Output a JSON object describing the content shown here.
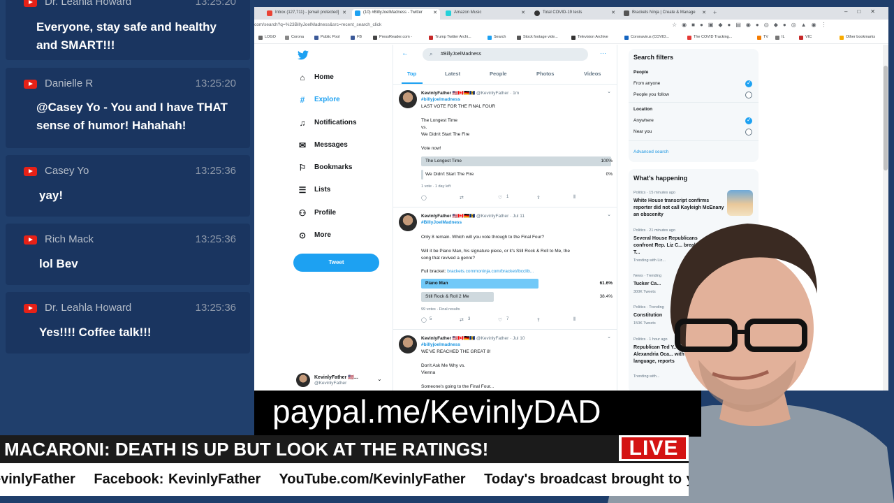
{
  "chat": {
    "messages": [
      {
        "name": "Dr. Leahla Howard",
        "time": "13:25:20",
        "text": "Everyone, stay safe and healthy and SMART!!!"
      },
      {
        "name": "Danielle R",
        "time": "13:25:20",
        "text": "@Casey Yo - You and I have THAT sense of humor! Hahahah!"
      },
      {
        "name": "Casey Yo",
        "time": "13:25:36",
        "text": "yay!"
      },
      {
        "name": "Rich Mack",
        "time": "13:25:36",
        "text": "lol Bev"
      },
      {
        "name": "Dr. Leahla Howard",
        "time": "13:25:36",
        "text": "Yes!!!! Coffee talk!!!"
      }
    ]
  },
  "browser": {
    "tabs": [
      {
        "label": "Inbox (127,711) - [email protected]",
        "color": "#ea4335"
      },
      {
        "label": "(10) #BillyJoelMadness - Twitter",
        "color": "#1da1f2"
      },
      {
        "label": "Amazon Music",
        "color": "#25d1da"
      },
      {
        "label": "Total COVID-19 tests",
        "color": "#333333"
      },
      {
        "label": "Brackets Ninja | Create & Manage",
        "color": "#555555"
      }
    ],
    "url": "com/search?q=%23BillyJoelMadness&src=recent_search_click",
    "bookmarks": [
      {
        "label": "LOGO",
        "color": "#666666"
      },
      {
        "label": "Corona",
        "color": "#888888"
      },
      {
        "label": "Public Pool",
        "color": "#3b5998"
      },
      {
        "label": "FB",
        "color": "#3b5998"
      },
      {
        "label": "PressReader.com -",
        "color": "#444444"
      },
      {
        "label": "Trump Twitter Archi...",
        "color": "#c62828"
      },
      {
        "label": "Search",
        "color": "#1da1f2"
      },
      {
        "label": "Stock footage vide...",
        "color": "#555555"
      },
      {
        "label": "Television Archive",
        "color": "#333333"
      },
      {
        "label": "Coronavirus (COVID...",
        "color": "#1565c0"
      },
      {
        "label": "The COVID Tracking...",
        "color": "#e53935"
      },
      {
        "label": "TV",
        "color": "#f57c00"
      },
      {
        "label": "IL",
        "color": "#777777"
      },
      {
        "label": "VIC",
        "color": "#c62828"
      },
      {
        "label": "Other bookmarks",
        "color": "#f9ab00"
      }
    ]
  },
  "twitter": {
    "nav": [
      "Home",
      "Explore",
      "Notifications",
      "Messages",
      "Bookmarks",
      "Lists",
      "Profile",
      "More"
    ],
    "tweet_button": "Tweet",
    "account_name": "KevinlyFather 🇺🇸...",
    "account_handle": "@KevinlyFather",
    "search_value": "#BillyJoelMadness",
    "tabs": [
      "Top",
      "Latest",
      "People",
      "Photos",
      "Videos"
    ],
    "tweets": [
      {
        "name": "KevinlyFather 🇺🇸🇨🇦🇩🇪🇧🇧",
        "handle": "@KevinlyFather · 1m",
        "tag": "#billyjoelmadness",
        "lines": [
          "LAST VOTE FOR THE FINAL FOUR",
          "",
          "The Longest Time",
          "vs.",
          "We Didn't Start The Fire",
          "",
          "Vote now!"
        ],
        "poll": [
          {
            "label": "The Longest Time",
            "pct": "100%",
            "fill": 1.0
          },
          {
            "label": "We Didn't Start The Fire",
            "pct": "0%",
            "fill": 0.0
          }
        ],
        "meta": "1 vote · 1 day left",
        "likes": "1"
      },
      {
        "name": "KevinlyFather 🇺🇸🇨🇦🇩🇪🇧🇧",
        "handle": "@KevinlyFather · Jul 11",
        "tag": "#BillyJoelMadness",
        "lines": [
          "Only 8 remain. Which will you vote through to the Final Four?",
          "",
          "Will it be Piano Man, his signature piece, or it's Still Rock & Roll to Me, the",
          "song that revived a genre?",
          "",
          "Full bracket: "
        ],
        "link": "brackets.commoninja.com/bracket/ibcclib...",
        "poll": [
          {
            "label": "Piano Man",
            "pct": "61.6%",
            "fill": 0.616
          },
          {
            "label": "Still Rock & Roll 2 Me",
            "pct": "38.4%",
            "fill": 0.384
          }
        ],
        "meta": "99 votes · Final results",
        "replies": "5",
        "retweets": "3",
        "likes": "7"
      },
      {
        "name": "KevinlyFather 🇺🇸🇨🇦🇩🇪🇧🇧",
        "handle": "@KevinlyFather · Jul 10",
        "tag": "#billyjoelmadness",
        "lines": [
          "WE'VE REACHED THE GREAT 8!",
          "",
          "Don't Ask Me Why vs.",
          "Vienna",
          "",
          "Someone's going to the Final Four..."
        ]
      }
    ],
    "filters": {
      "title": "Search filters",
      "people_label": "People",
      "people_opts": [
        "From anyone",
        "People you follow"
      ],
      "location_label": "Location",
      "location_opts": [
        "Anywhere",
        "Near you"
      ],
      "advanced": "Advanced search"
    },
    "happening": {
      "title": "What's happening",
      "items": [
        {
          "meta": "Politics · 15 minutes ago",
          "title": "White House transcript confirms reporter did not call Kayleigh McEnany an obscenity"
        },
        {
          "meta": "Politics · 21 minutes ago",
          "title": "Several House Republicans confront Rep. Liz C... breaking with T...",
          "sub": "Trending with Liz..."
        },
        {
          "meta": "News · Trending",
          "title": "Tucker Ca...",
          "sub": "300K Tweets"
        },
        {
          "meta": "Politics · Trending",
          "title": "Constitution",
          "sub": "150K Tweets"
        },
        {
          "meta": "Politics · 1 hour ago",
          "title": "Republican Ted Y... Rep. Alexandria Oca... with crude language, reports",
          "sub": "Trending with..."
        }
      ]
    }
  },
  "overlay": {
    "paypal": "paypal.me/KevinlyDAD",
    "headline": "MACARONI: DEATH IS UP BUT LOOK AT THE RATINGS!",
    "live": "LIVE",
    "ticker": [
      "evinlyFather",
      "Facebook: KevinlyFather",
      "YouTube.com/KevinlyFather",
      "Today's broadcast brought to you by"
    ]
  }
}
